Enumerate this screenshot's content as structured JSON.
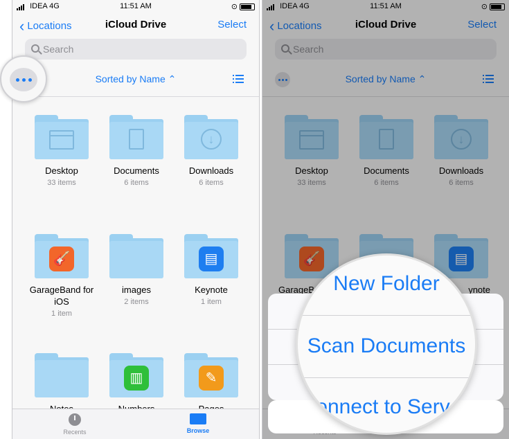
{
  "status": {
    "carrier": "IDEA 4G",
    "time": "11:51 AM"
  },
  "nav": {
    "back_label": "Locations",
    "title": "iCloud Drive",
    "select_label": "Select"
  },
  "search": {
    "placeholder": "Search"
  },
  "sort": {
    "label": "Sorted by Name"
  },
  "items": [
    {
      "name": "Desktop",
      "count": "33 items",
      "icon": "desktop-icon"
    },
    {
      "name": "Documents",
      "count": "6 items",
      "icon": "document-icon"
    },
    {
      "name": "Downloads",
      "count": "6 items",
      "icon": "download-icon"
    },
    {
      "name": "GarageBand for iOS",
      "count": "1 item",
      "icon": "garageband-icon"
    },
    {
      "name": "images",
      "count": "2 items",
      "icon": ""
    },
    {
      "name": "Keynote",
      "count": "1 item",
      "icon": "keynote-icon"
    },
    {
      "name": "Notes",
      "count": "",
      "icon": ""
    },
    {
      "name": "Numbers",
      "count": "",
      "icon": "numbers-icon"
    },
    {
      "name": "Pages",
      "count": "",
      "icon": "pages-icon"
    }
  ],
  "right_items_visible": [
    {
      "name": "Desktop",
      "count": "33 items"
    },
    {
      "name": "Documents",
      "count": "6 items"
    },
    {
      "name": "Downloads",
      "count": "6 items"
    },
    {
      "name": "GarageB"
    },
    {
      "name": "ynote"
    }
  ],
  "tabbar": {
    "recents": "Recents",
    "browse": "Browse"
  },
  "menu": {
    "new_folder": "New Folder",
    "scan_documents": "Scan Documents",
    "connect_server": "onnect to Serv"
  },
  "colors": {
    "accent": "#1a7cf5",
    "folder": "#9bd0f1"
  }
}
